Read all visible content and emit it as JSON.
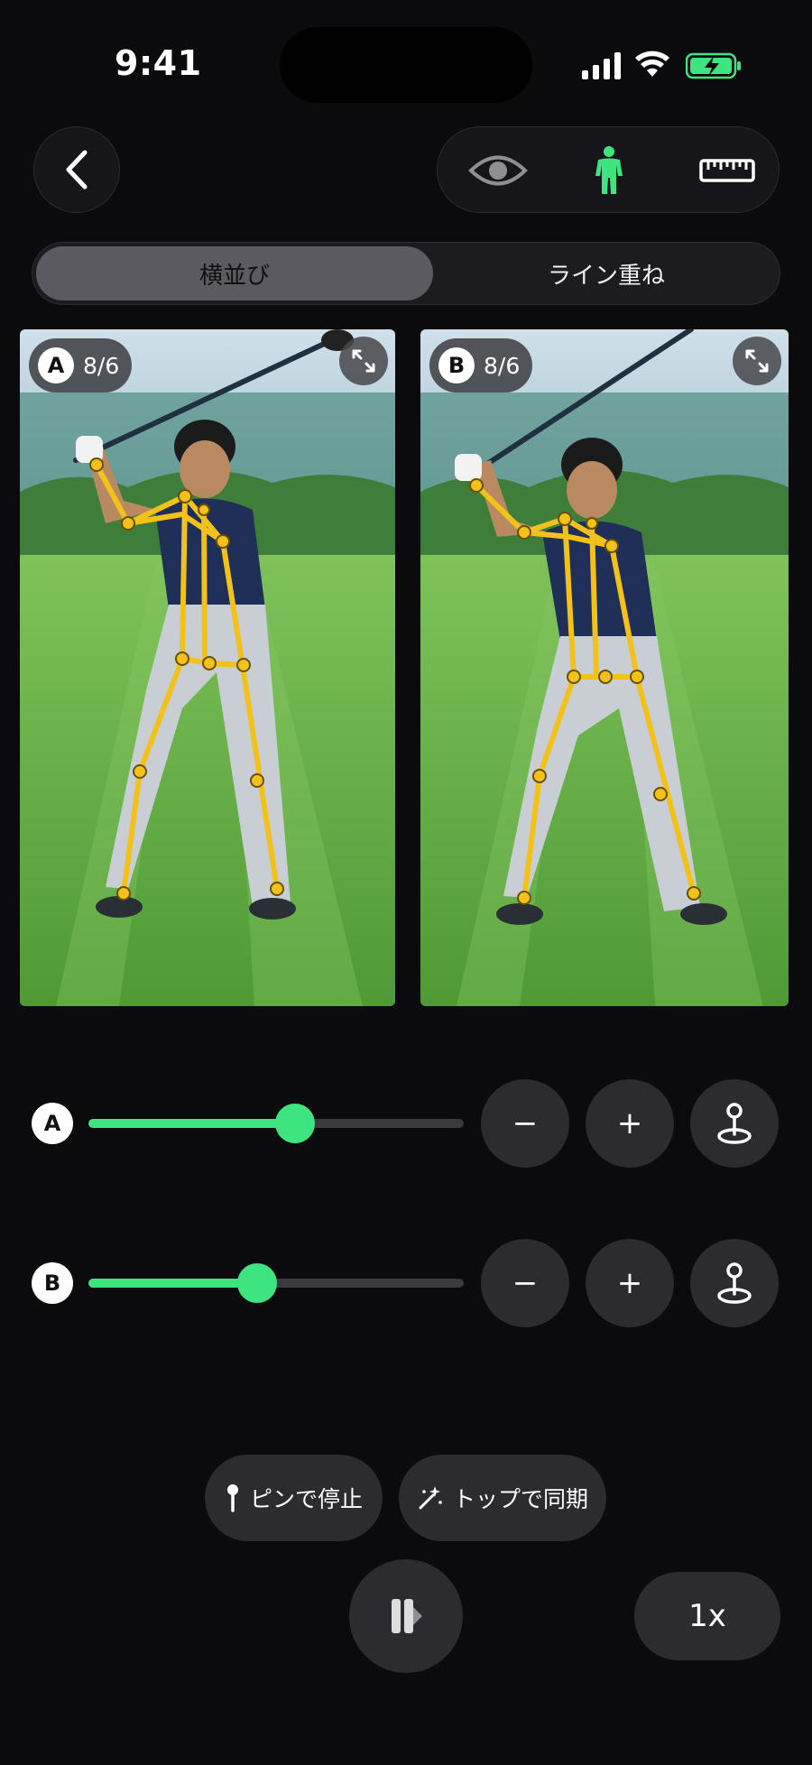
{
  "status_bar": {
    "time": "9:41"
  },
  "toolbar": {
    "back_icon": "chevron-left-icon",
    "tools": [
      "eye-icon",
      "person-icon",
      "ruler-icon"
    ],
    "active_tool_color": "#3ee47f"
  },
  "view_mode": {
    "options": [
      "横並び",
      "ライン重ね"
    ],
    "selected": "横並び"
  },
  "panels": [
    {
      "letter": "A",
      "frame": "8/6"
    },
    {
      "letter": "B",
      "frame": "8/6"
    }
  ],
  "scrubbers": [
    {
      "letter": "A",
      "progress": 0.55,
      "minus_label": "−",
      "plus_label": "+"
    },
    {
      "letter": "B",
      "progress": 0.45,
      "minus_label": "−",
      "plus_label": "+"
    }
  ],
  "actions": {
    "pin_stop": "ピンで停止",
    "sync_top": "トップで同期",
    "speed": "1x"
  },
  "colors": {
    "accent": "#3ee47f",
    "skeleton": "#f2c21b",
    "background": "#0b0b0e"
  }
}
